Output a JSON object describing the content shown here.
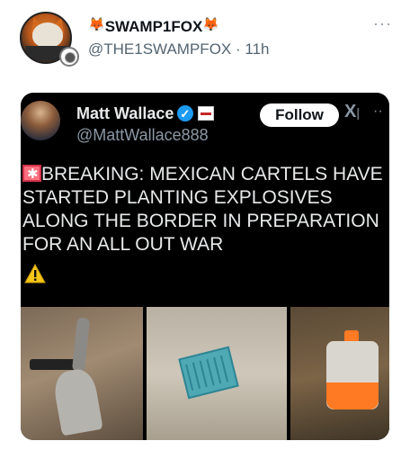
{
  "post": {
    "author_name": "SWAMP1FOX",
    "author_emoji_left": "🦊",
    "author_emoji_right": "🦊",
    "author_handle": "@THE1SWAMPFOX",
    "separator": "·",
    "time_ago": "11h",
    "more_icon": "more-horizontal-icon"
  },
  "quoted": {
    "name": "Matt Wallace",
    "handle": "@MattWallace888",
    "follow_label": "Follow",
    "x_logo": "X",
    "more": "··",
    "text": "BREAKING: MEXICAN CARTELS HAVE STARTED PLANTING EXPLOSIVES ALONG THE BORDER IN PREPARATION FOR AN ALL OUT WAR",
    "siren_icon": "siren-icon",
    "warning_icon": "warning-icon",
    "verified_color": "#1d9bf0",
    "photos": [
      "photo-shovel",
      "photo-basket",
      "photo-orange-can"
    ]
  },
  "colors": {
    "card_bg": "#000000",
    "text_light": "#e7e9ea",
    "muted": "#536471"
  }
}
